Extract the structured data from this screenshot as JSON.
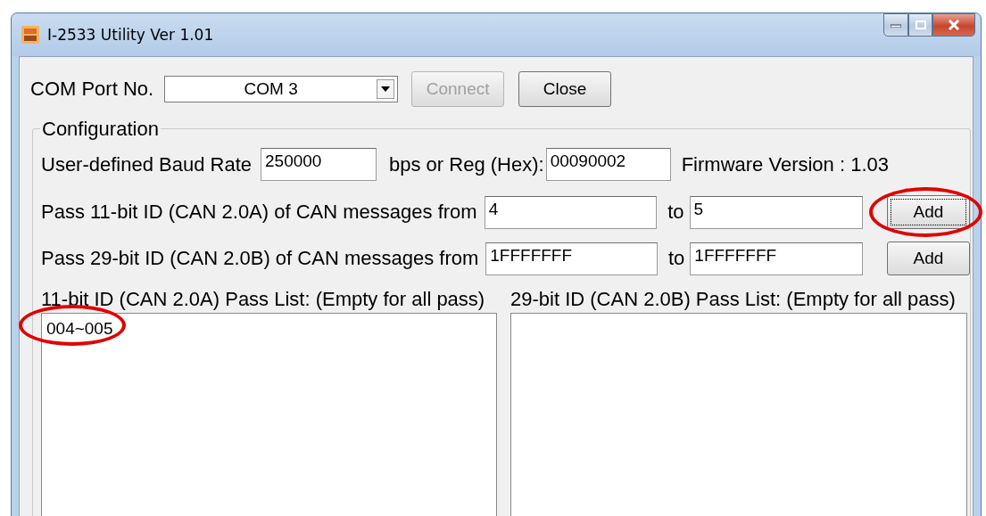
{
  "window": {
    "title": "I-2533 Utility Ver 1.01"
  },
  "com_port": {
    "label": "COM Port No.",
    "value": "COM 3",
    "buttons": [
      {
        "label": "Connect",
        "disabled": true,
        "focused": false
      },
      {
        "label": "Close",
        "disabled": false,
        "focused": false
      }
    ]
  },
  "configuration": {
    "title": "Configuration",
    "baud": {
      "label": "User-defined Baud Rate",
      "value": "250000",
      "reg_label": "bps or Reg (Hex):",
      "reg_value": "00090002",
      "firmware": "Firmware Version : 1.03"
    },
    "ranges": [
      {
        "label": "Pass 11-bit ID (CAN 2.0A) of CAN messages from",
        "from": "4",
        "to_label": "to",
        "to": "5",
        "button": "Add",
        "focused": true,
        "highlighted": true
      },
      {
        "label": "Pass 29-bit ID (CAN 2.0B) of CAN messages from",
        "from": "1FFFFFFF",
        "to_label": "to",
        "to": "1FFFFFFF",
        "button": "Add",
        "focused": false,
        "highlighted": false
      }
    ],
    "lists": [
      {
        "label": "11-bit ID (CAN 2.0A) Pass List: (Empty for all pass)",
        "items": [
          {
            "text": "004~005",
            "highlighted": true
          }
        ]
      },
      {
        "label": "29-bit ID (CAN 2.0B) Pass List: (Empty for all pass)"
      }
    ]
  }
}
